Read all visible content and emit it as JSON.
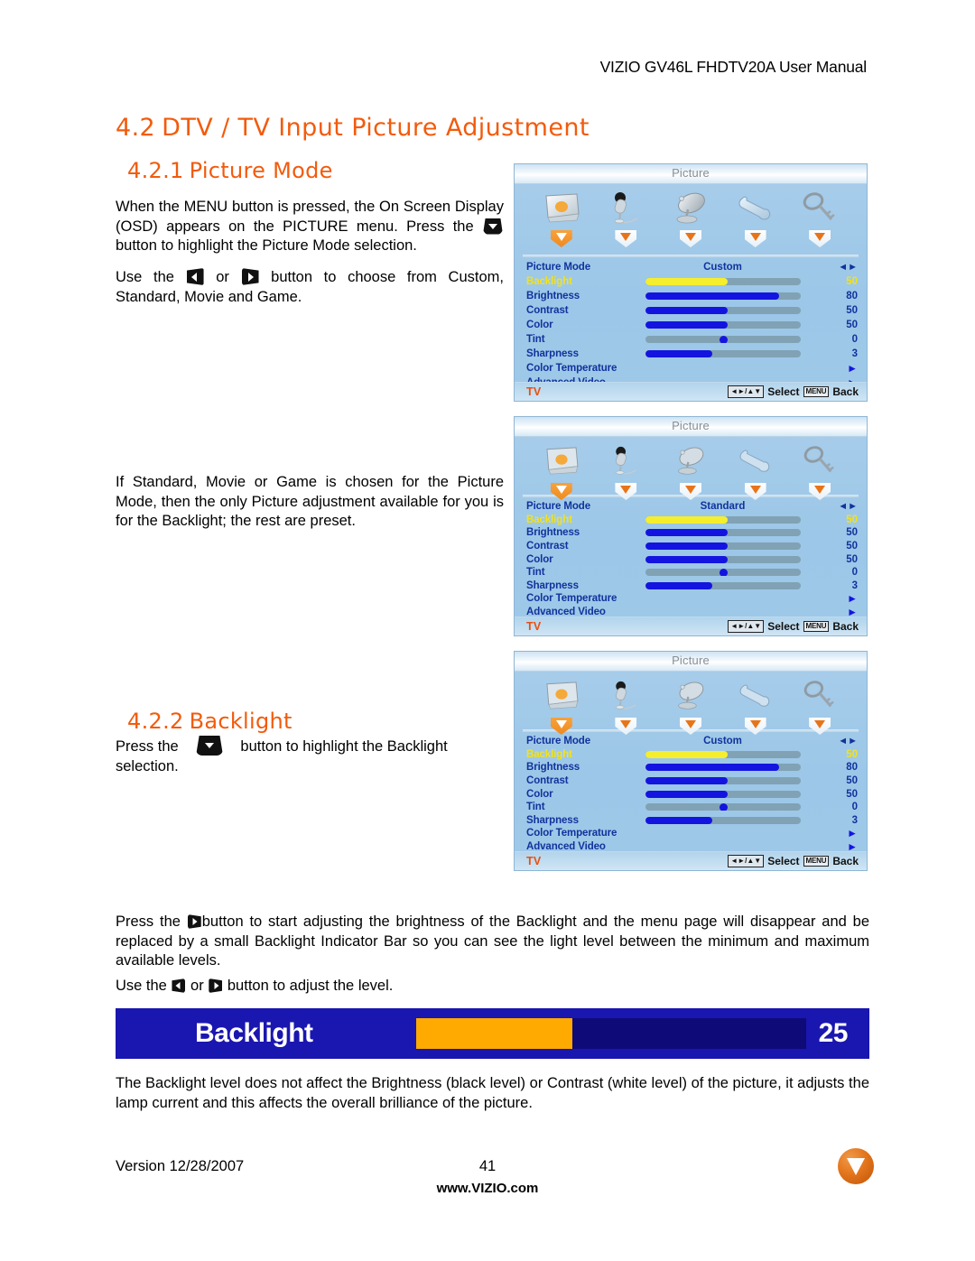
{
  "header": {
    "title": "VIZIO GV46L FHDTV20A User Manual"
  },
  "headings": {
    "section_num": "4.2",
    "section_title": "DTV / TV Input Picture Adjustment",
    "sub1_num": "4.2.1",
    "sub1_title": "Picture Mode",
    "sub2_num": "4.2.2",
    "sub2_title": "Backlight"
  },
  "body": {
    "p1_a": "When the MENU button is pressed, the On Screen Display (OSD) appears on the PICTURE menu.  Press the ",
    "p1_b": "button to highlight the Picture Mode selection.",
    "p2_a": "Use the ",
    "p2_b": " or ",
    "p2_c": " button to choose from Custom, Standard, Movie and Game.",
    "p3": "If Standard, Movie or Game is chosen for the Picture Mode, then the only Picture adjustment available for you is for the Backlight; the rest are preset.",
    "p4_a": "Press the ",
    "p4_b": "button to highlight the Backlight selection.",
    "p5_a": " Press the ",
    "p5_b": "button to start adjusting the brightness of the Backlight and the menu page will disappear and be replaced by a small Backlight Indicator Bar so you can see the light level between the minimum and maximum available levels.",
    "p6_a": "Use the ",
    "p6_b": " or ",
    "p6_c": " button to adjust the level.",
    "p7": "The Backlight level does not affect the Brightness (black level) or Contrast (white level) of the picture, it adjusts the lamp current and this affects the overall brilliance of the picture."
  },
  "osd_common": {
    "title": "Picture",
    "source": "TV",
    "select_label": "Select",
    "back_label": "Back",
    "menu_chip": "MENU",
    "nav_chip": "◄► / ▲▼",
    "tabs": [
      {
        "icon": "picture-screen-icon",
        "active": true
      },
      {
        "icon": "microphone-audio-icon",
        "active": false
      },
      {
        "icon": "satellite-dish-tuner-icon",
        "active": false
      },
      {
        "icon": "wrench-setup-icon",
        "active": false
      },
      {
        "icon": "key-parental-icon",
        "active": false
      }
    ],
    "row_labels": {
      "picture_mode": "Picture Mode",
      "backlight": "Backlight",
      "brightness": "Brightness",
      "contrast": "Contrast",
      "color": "Color",
      "tint": "Tint",
      "sharpness": "Sharpness",
      "color_temperature": "Color Temperature",
      "advanced_video": "Advanced Video"
    }
  },
  "osd_panels": [
    {
      "id": "osd-custom-1",
      "picture_mode": "Custom",
      "values": {
        "backlight": 50,
        "brightness": 80,
        "contrast": 50,
        "color": 50,
        "tint": 0,
        "sharpness": 3
      },
      "fills_pct": {
        "backlight": 53,
        "brightness": 86,
        "contrast": 53,
        "color": 53,
        "tint": 50,
        "sharpness": 43
      }
    },
    {
      "id": "osd-standard",
      "picture_mode": "Standard",
      "values": {
        "backlight": 50,
        "brightness": 50,
        "contrast": 50,
        "color": 50,
        "tint": 0,
        "sharpness": 3
      },
      "fills_pct": {
        "backlight": 53,
        "brightness": 53,
        "contrast": 53,
        "color": 53,
        "tint": 50,
        "sharpness": 43
      }
    },
    {
      "id": "osd-custom-2",
      "picture_mode": "Custom",
      "values": {
        "backlight": 50,
        "brightness": 80,
        "contrast": 50,
        "color": 50,
        "tint": 0,
        "sharpness": 3
      },
      "fills_pct": {
        "backlight": 53,
        "brightness": 86,
        "contrast": 53,
        "color": 53,
        "tint": 50,
        "sharpness": 43
      }
    }
  ],
  "backlight_indicator": {
    "label": "Backlight",
    "value": "25",
    "fill_pct": 40
  },
  "footer": {
    "version": "Version 12/28/2007",
    "page_number": "41",
    "website": "www.VIZIO.com",
    "logo": "vizio-v-logo"
  },
  "colors": {
    "heading_orange": "#F25B0C",
    "osd_label_blue": "#11339c",
    "osd_highlight_yellow": "#F2E21C",
    "slider_blue": "#1414E0",
    "slider_yellow": "#F5EE2E",
    "slider_track": "#80a2b4",
    "indicator_bg": "#1A16B0",
    "indicator_fill": "#FFAA00",
    "vizio_orange": "#E3751C"
  }
}
